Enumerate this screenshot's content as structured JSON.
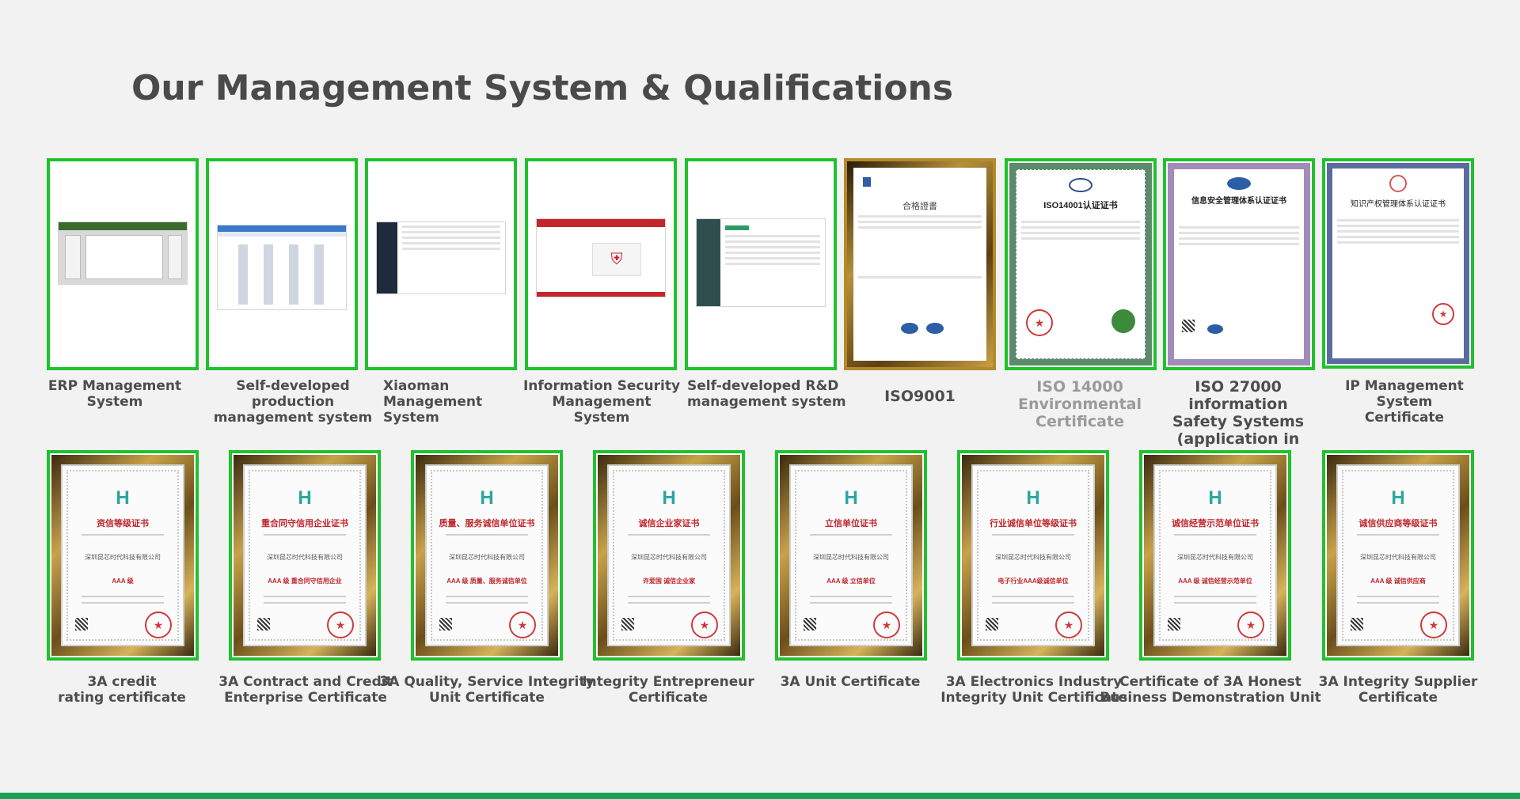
{
  "page": {
    "title": "Our Management System & Qualifications"
  },
  "colors": {
    "accent_green": "#1fc22c",
    "bottom_bar": "#1aa25a",
    "title_text": "#4a4a4a",
    "cert_red": "#c0262d"
  },
  "row1": [
    {
      "label_lines": [
        "ERP Management System"
      ],
      "kind": "screenshot-erp"
    },
    {
      "label_lines": [
        "Self-developed production",
        "management system"
      ],
      "kind": "screenshot-production"
    },
    {
      "label_lines": [
        "Xiaoman",
        "Management System"
      ],
      "kind": "screenshot-xiaoman"
    },
    {
      "label_lines": [
        "Information Security",
        "Management System"
      ],
      "kind": "screenshot-infosec"
    },
    {
      "label_lines": [
        "Self-developed R&D",
        "management system"
      ],
      "kind": "screenshot-rnd"
    },
    {
      "label_lines": [
        "ISO9001"
      ],
      "kind": "certificate-iso9001",
      "cert_heading": "合格證書"
    },
    {
      "label_lines": [
        "ISO 14000",
        "Environmental Certificate"
      ],
      "kind": "certificate-iso14001",
      "cert_heading": "ISO14001认证证书"
    },
    {
      "label_lines": [
        "ISO 27000 information",
        "Safety Systems",
        "(application in progress)"
      ],
      "kind": "certificate-iso27001",
      "cert_heading": "信息安全管理体系认证证书"
    },
    {
      "label_lines": [
        "IP Management System",
        "Certificate"
      ],
      "kind": "certificate-ip",
      "cert_heading": "知识产权管理体系认证证书"
    }
  ],
  "row2": [
    {
      "label_lines": [
        "3A credit",
        "rating certificate"
      ],
      "cert_heading": "资信等级证书",
      "company": "深圳昆芯时代科技有限公司",
      "grade": "AAA 级"
    },
    {
      "label_lines": [
        "3A Contract and Credit",
        "Enterprise Certificate"
      ],
      "cert_heading": "重合同守信用企业证书",
      "company": "深圳昆芯时代科技有限公司",
      "grade": "AAA 级 重合同守信用企业"
    },
    {
      "label_lines": [
        "3A Quality, Service Integrity",
        "Unit Certificate"
      ],
      "cert_heading": "质量、服务诚信单位证书",
      "company": "深圳昆芯时代科技有限公司",
      "grade": "AAA 级 质量、服务诚信单位"
    },
    {
      "label_lines": [
        "Integrity Entrepreneur",
        "Certificate"
      ],
      "cert_heading": "诚信企业家证书",
      "company": "深圳昆芯时代科技有限公司",
      "grade": "许爱国 诚信企业家"
    },
    {
      "label_lines": [
        "3A Unit Certificate"
      ],
      "cert_heading": "立信单位证书",
      "company": "深圳昆芯时代科技有限公司",
      "grade": "AAA 级 立信单位"
    },
    {
      "label_lines": [
        "3A Electronics Industry",
        "Integrity Unit Certificate"
      ],
      "cert_heading": "行业诚信单位等级证书",
      "company": "深圳昆芯时代科技有限公司",
      "grade": "电子行业AAA级诚信单位"
    },
    {
      "label_lines": [
        "Certificate of 3A Honest",
        "Business Demonstration Unit"
      ],
      "cert_heading": "诚信经营示范单位证书",
      "company": "深圳昆芯时代科技有限公司",
      "grade": "AAA 级 诚信经营示范单位"
    },
    {
      "label_lines": [
        "3A Integrity Supplier",
        "Certificate"
      ],
      "cert_heading": "诚信供应商等级证书",
      "company": "深圳昆芯时代科技有限公司",
      "grade": "AAA 级 诚信供应商"
    }
  ]
}
